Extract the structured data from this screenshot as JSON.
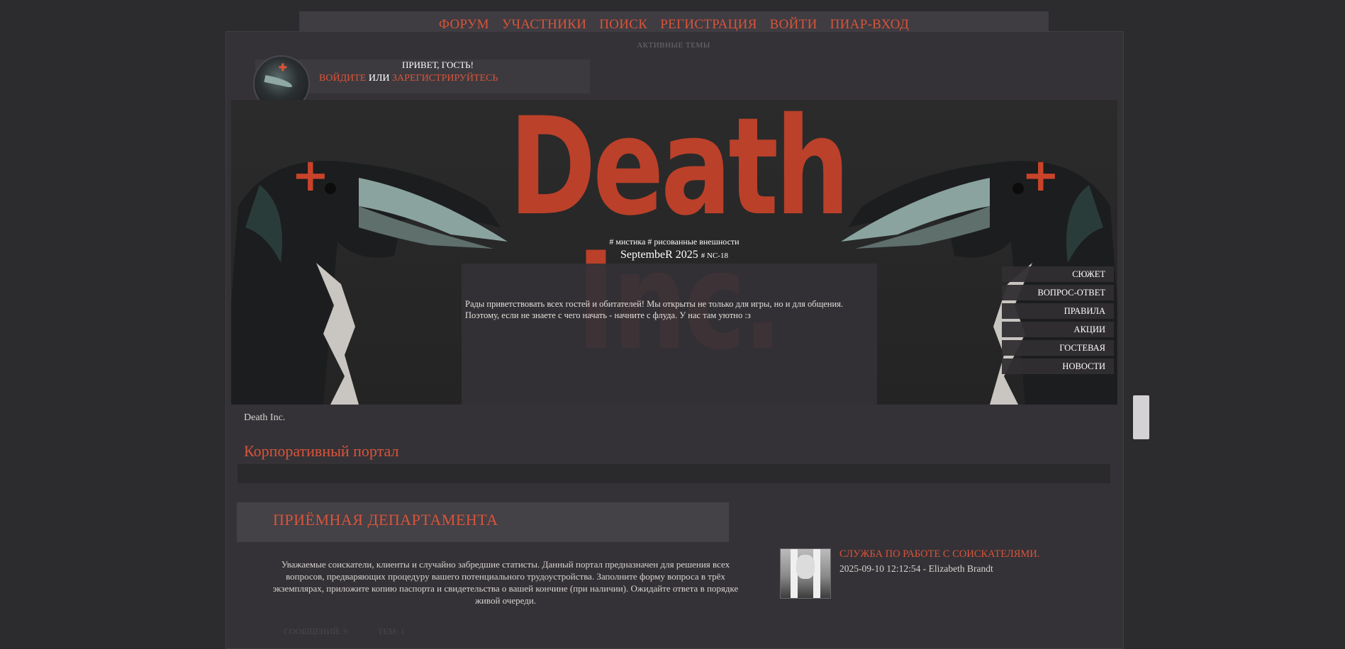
{
  "nav": {
    "items": [
      "ФОРУМ",
      "УЧАСТНИКИ",
      "ПОИСК",
      "РЕГИСТРАЦИЯ",
      "ВОЙТИ",
      "ПИАР-ВХОД"
    ]
  },
  "active_topics": "АКТИВНЫЕ ТЕМЫ",
  "guest": {
    "greeting": "ПРИВЕТ, ГОСТЬ!",
    "login_link": "ВОЙДИТЕ",
    "or_text": " ИЛИ ",
    "register_link": "ЗАРЕГИСТРИРУЙТЕСЬ"
  },
  "banner": {
    "title": "Death Inc.",
    "tags": "# мистика # рисованные внешности",
    "date": "SeptembeR 2025",
    "rating": "# NC-18",
    "welcome_text": "Рады приветствовать всех гостей и обитателей! Мы открыты не только для игры, но и для общения. Поэтому, если не знаете с чего начать - начните с флуда. У нас там уютно :з",
    "side_menu": [
      "СЮЖЕТ",
      "ВОПРОС-ОТВЕТ",
      "ПРАВИЛА",
      "АКЦИИ",
      "ГОСТЕВАЯ",
      "НОВОСТИ"
    ]
  },
  "breadcrumb": "Death Inc.",
  "portal_title": "Корпоративный портал",
  "department": {
    "title": "ПРИЁМНАЯ ДЕПАРТАМЕНТА",
    "description": "Уважаемые соискатели, клиенты и случайно забредшие статисты. Данный портал предназначен для решения всех вопросов, предваряющих процедуру вашего потенциального трудоустройства. Заполните форму вопроса в трёх экземплярах, приложите копию паспорта и свидетельства о вашей кончине (при наличии). Ожидайте ответа в порядке живой очереди."
  },
  "last_post": {
    "title": "СЛУЖБА ПО РАБОТЕ С СОИСКАТЕЛЯМИ.",
    "meta": "2025-09-10 12:12:54 - Elizabeth Brandt"
  },
  "stats": {
    "posts": "СООБЩЕНИЙ: 9",
    "topics": "ТЕМ: 1"
  },
  "colors": {
    "accent": "#d9543a",
    "background": "#2c2b2d",
    "panel": "#353237"
  }
}
